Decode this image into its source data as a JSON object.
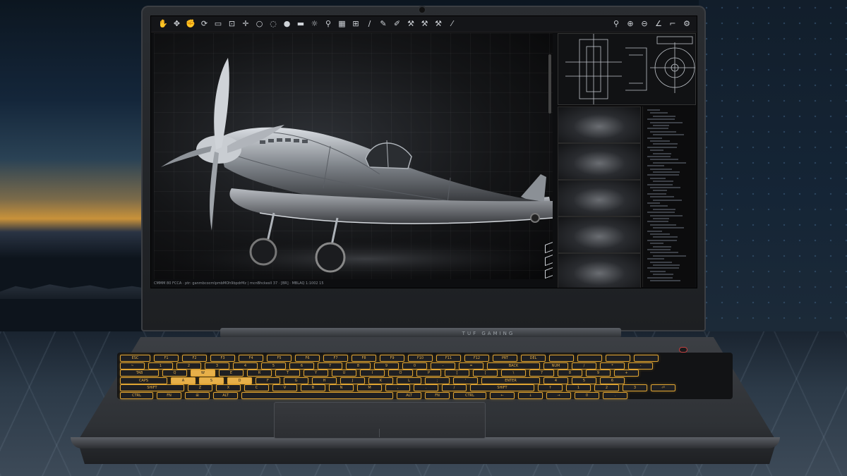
{
  "screen": {
    "status_text": "CMMM 80 FCCA · ptr: ganmbcocmlpmbMOh9bpdrMz    |    mcnBhckesll 37 · [BR] · MBLAQ 1:1002 15",
    "toolbar_icons": [
      "hand-icon",
      "pan-icon",
      "grab-icon",
      "rotate-icon",
      "select-icon",
      "frame-icon",
      "move-icon",
      "circle-icon",
      "orbit-icon",
      "sphere-icon",
      "line-icon",
      "light-icon",
      "pin-icon",
      "grid-icon",
      "group-icon",
      "measure-icon",
      "draw-icon",
      "pen-icon",
      "tool-icon",
      "tool-icon",
      "tool-icon",
      "brush-icon"
    ],
    "right_tools": [
      "zoom-icon",
      "zoom-in-icon",
      "zoom-out-icon",
      "angle-icon",
      "crop-icon",
      "settings-icon"
    ]
  },
  "laptop": {
    "logo_text": "TUF GAMING"
  },
  "keyboard": {
    "rows": [
      [
        "ESC",
        "F1",
        "F2",
        "F3",
        "F4",
        "F5",
        "F6",
        "F7",
        "F8",
        "F9",
        "F10",
        "F11",
        "F12",
        "PRT",
        "DEL",
        "",
        "",
        "",
        ""
      ],
      [
        "~",
        "1",
        "2",
        "3",
        "4",
        "5",
        "6",
        "7",
        "8",
        "9",
        "0",
        "-",
        "=",
        "BACK",
        "NUM",
        "/",
        "*",
        "-"
      ],
      [
        "TAB",
        "Q",
        "W",
        "E",
        "R",
        "T",
        "Y",
        "U",
        "I",
        "O",
        "P",
        "[",
        "]",
        "\\",
        "7",
        "8",
        "9",
        "+"
      ],
      [
        "CAPS",
        "A",
        "S",
        "D",
        "F",
        "G",
        "H",
        "J",
        "K",
        "L",
        ";",
        "'",
        "ENTER",
        "4",
        "5",
        "6"
      ],
      [
        "SHIFT",
        "Z",
        "X",
        "C",
        "V",
        "B",
        "N",
        "M",
        ",",
        ".",
        "/",
        "SHIFT",
        "↑",
        "1",
        "2",
        "3",
        "⏎"
      ],
      [
        "CTRL",
        "FN",
        "⊞",
        "ALT",
        "",
        "ALT",
        "FN",
        "CTRL",
        "←",
        "↓",
        "→",
        "0",
        "."
      ]
    ],
    "accent": "#e7b04a"
  }
}
